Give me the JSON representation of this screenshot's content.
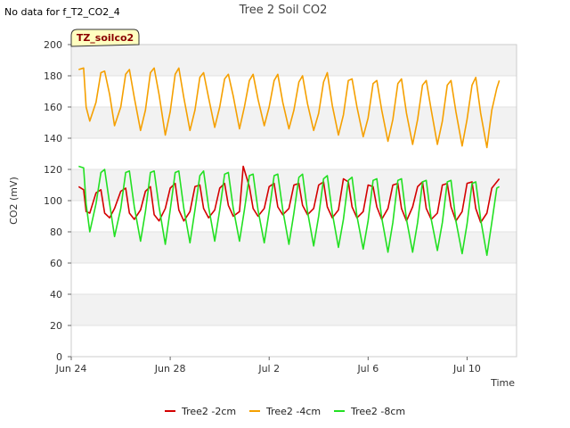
{
  "no_data_note": "No data for f_T2_CO2_4",
  "badge": "TZ_soilco2",
  "colors": {
    "tree2_2cm": "#d40000",
    "tree2_4cm": "#f5a000",
    "tree2_8cm": "#22e022",
    "badge_bg": "#ffffc0",
    "badge_text": "#8b0000"
  },
  "chart_data": {
    "type": "line",
    "title": "Tree 2 Soil CO2",
    "xlabel": "Time",
    "ylabel": "CO2 (mV)",
    "xlim": [
      0,
      18
    ],
    "ylim": [
      0,
      200
    ],
    "x_ticks": [
      {
        "value": 0,
        "label": "Jun 24"
      },
      {
        "value": 4,
        "label": "Jun 28"
      },
      {
        "value": 8,
        "label": "Jul 2"
      },
      {
        "value": 12,
        "label": "Jul 6"
      },
      {
        "value": 16,
        "label": "Jul 10"
      }
    ],
    "y_ticks": [
      0,
      20,
      40,
      60,
      80,
      100,
      120,
      140,
      160,
      180,
      200
    ],
    "grid": true,
    "legend_position": "bottom",
    "x_start": 0.3,
    "x_end": 17.3,
    "series": [
      {
        "name": "Tree2 -2cm",
        "color": "#d40000",
        "x_days": [
          0.3,
          0.5,
          0.6,
          0.75,
          1.0,
          1.2,
          1.35,
          1.55,
          1.75,
          2.0,
          2.2,
          2.35,
          2.55,
          2.8,
          3.0,
          3.2,
          3.35,
          3.55,
          3.8,
          4.0,
          4.2,
          4.35,
          4.55,
          4.8,
          5.0,
          5.2,
          5.35,
          5.55,
          5.8,
          6.0,
          6.2,
          6.35,
          6.55,
          6.8,
          6.95,
          7.2,
          7.35,
          7.55,
          7.8,
          8.0,
          8.2,
          8.35,
          8.55,
          8.8,
          9.0,
          9.2,
          9.35,
          9.55,
          9.8,
          10.0,
          10.2,
          10.35,
          10.55,
          10.8,
          11.0,
          11.2,
          11.35,
          11.55,
          11.8,
          12.0,
          12.2,
          12.35,
          12.55,
          12.8,
          13.0,
          13.2,
          13.35,
          13.55,
          13.8,
          14.0,
          14.2,
          14.35,
          14.55,
          14.8,
          15.0,
          15.2,
          15.35,
          15.55,
          15.8,
          16.0,
          16.2,
          16.35,
          16.55,
          16.8,
          17.0,
          17.2,
          17.3
        ],
        "values": [
          109,
          107,
          93,
          92,
          105,
          107,
          92,
          89,
          95,
          106,
          108,
          92,
          88,
          94,
          106,
          109,
          91,
          87,
          95,
          108,
          111,
          94,
          87,
          93,
          109,
          110,
          95,
          89,
          94,
          108,
          111,
          97,
          90,
          93,
          122,
          109,
          95,
          90,
          95,
          109,
          111,
          96,
          91,
          95,
          110,
          111,
          97,
          91,
          95,
          110,
          112,
          96,
          89,
          94,
          114,
          112,
          96,
          89,
          93,
          110,
          109,
          96,
          88,
          95,
          110,
          111,
          95,
          87,
          96,
          109,
          112,
          95,
          88,
          92,
          110,
          111,
          96,
          87,
          93,
          111,
          112,
          95,
          86,
          92,
          108,
          112,
          114
        ]
      },
      {
        "name": "Tree2 -4cm",
        "color": "#f5a000",
        "x_days": [
          0.3,
          0.5,
          0.6,
          0.75,
          1.0,
          1.2,
          1.35,
          1.55,
          1.75,
          2.0,
          2.2,
          2.35,
          2.55,
          2.8,
          3.0,
          3.2,
          3.35,
          3.55,
          3.8,
          4.0,
          4.2,
          4.35,
          4.55,
          4.8,
          5.0,
          5.2,
          5.35,
          5.55,
          5.8,
          6.0,
          6.2,
          6.35,
          6.55,
          6.8,
          7.0,
          7.2,
          7.35,
          7.55,
          7.8,
          8.0,
          8.2,
          8.35,
          8.55,
          8.8,
          9.0,
          9.2,
          9.35,
          9.55,
          9.8,
          10.0,
          10.2,
          10.35,
          10.55,
          10.8,
          11.0,
          11.2,
          11.35,
          11.55,
          11.8,
          12.0,
          12.2,
          12.35,
          12.55,
          12.8,
          13.0,
          13.2,
          13.35,
          13.55,
          13.8,
          14.0,
          14.2,
          14.35,
          14.55,
          14.8,
          15.0,
          15.2,
          15.35,
          15.55,
          15.8,
          16.0,
          16.2,
          16.35,
          16.55,
          16.8,
          17.0,
          17.2,
          17.3
        ],
        "values": [
          184,
          185,
          160,
          151,
          163,
          182,
          183,
          168,
          148,
          160,
          181,
          184,
          166,
          145,
          158,
          182,
          185,
          168,
          142,
          157,
          181,
          185,
          166,
          145,
          158,
          179,
          182,
          166,
          147,
          160,
          178,
          181,
          167,
          146,
          160,
          177,
          181,
          165,
          148,
          160,
          177,
          181,
          163,
          146,
          158,
          176,
          180,
          162,
          145,
          156,
          176,
          182,
          161,
          142,
          155,
          177,
          178,
          160,
          141,
          153,
          175,
          177,
          158,
          138,
          152,
          175,
          178,
          156,
          136,
          152,
          174,
          177,
          158,
          136,
          151,
          174,
          177,
          157,
          135,
          152,
          174,
          179,
          156,
          134,
          158,
          172,
          177
        ]
      },
      {
        "name": "Tree2 -8cm",
        "color": "#22e022",
        "x_days": [
          0.3,
          0.5,
          0.6,
          0.75,
          1.0,
          1.2,
          1.35,
          1.55,
          1.75,
          2.0,
          2.2,
          2.35,
          2.55,
          2.8,
          3.0,
          3.2,
          3.35,
          3.55,
          3.8,
          4.0,
          4.2,
          4.35,
          4.55,
          4.8,
          5.0,
          5.2,
          5.35,
          5.55,
          5.8,
          6.0,
          6.2,
          6.35,
          6.55,
          6.8,
          7.0,
          7.2,
          7.35,
          7.55,
          7.8,
          8.0,
          8.2,
          8.35,
          8.55,
          8.8,
          9.0,
          9.2,
          9.35,
          9.55,
          9.8,
          10.0,
          10.2,
          10.35,
          10.55,
          10.8,
          11.0,
          11.2,
          11.35,
          11.55,
          11.8,
          12.0,
          12.2,
          12.35,
          12.55,
          12.8,
          13.0,
          13.2,
          13.35,
          13.55,
          13.8,
          14.0,
          14.2,
          14.35,
          14.55,
          14.8,
          15.0,
          15.2,
          15.35,
          15.55,
          15.8,
          16.0,
          16.2,
          16.35,
          16.55,
          16.8,
          17.0,
          17.2,
          17.3
        ],
        "values": [
          122,
          121,
          98,
          80,
          98,
          118,
          120,
          98,
          77,
          95,
          118,
          119,
          96,
          74,
          93,
          118,
          119,
          96,
          72,
          94,
          118,
          119,
          95,
          73,
          94,
          116,
          119,
          96,
          74,
          94,
          117,
          118,
          95,
          74,
          94,
          116,
          117,
          94,
          73,
          93,
          116,
          117,
          94,
          72,
          92,
          115,
          117,
          93,
          71,
          90,
          114,
          116,
          92,
          70,
          88,
          113,
          115,
          90,
          69,
          87,
          113,
          114,
          89,
          67,
          86,
          113,
          114,
          88,
          67,
          86,
          112,
          113,
          88,
          68,
          86,
          112,
          113,
          87,
          66,
          85,
          111,
          112,
          88,
          65,
          86,
          108,
          109
        ]
      }
    ]
  }
}
